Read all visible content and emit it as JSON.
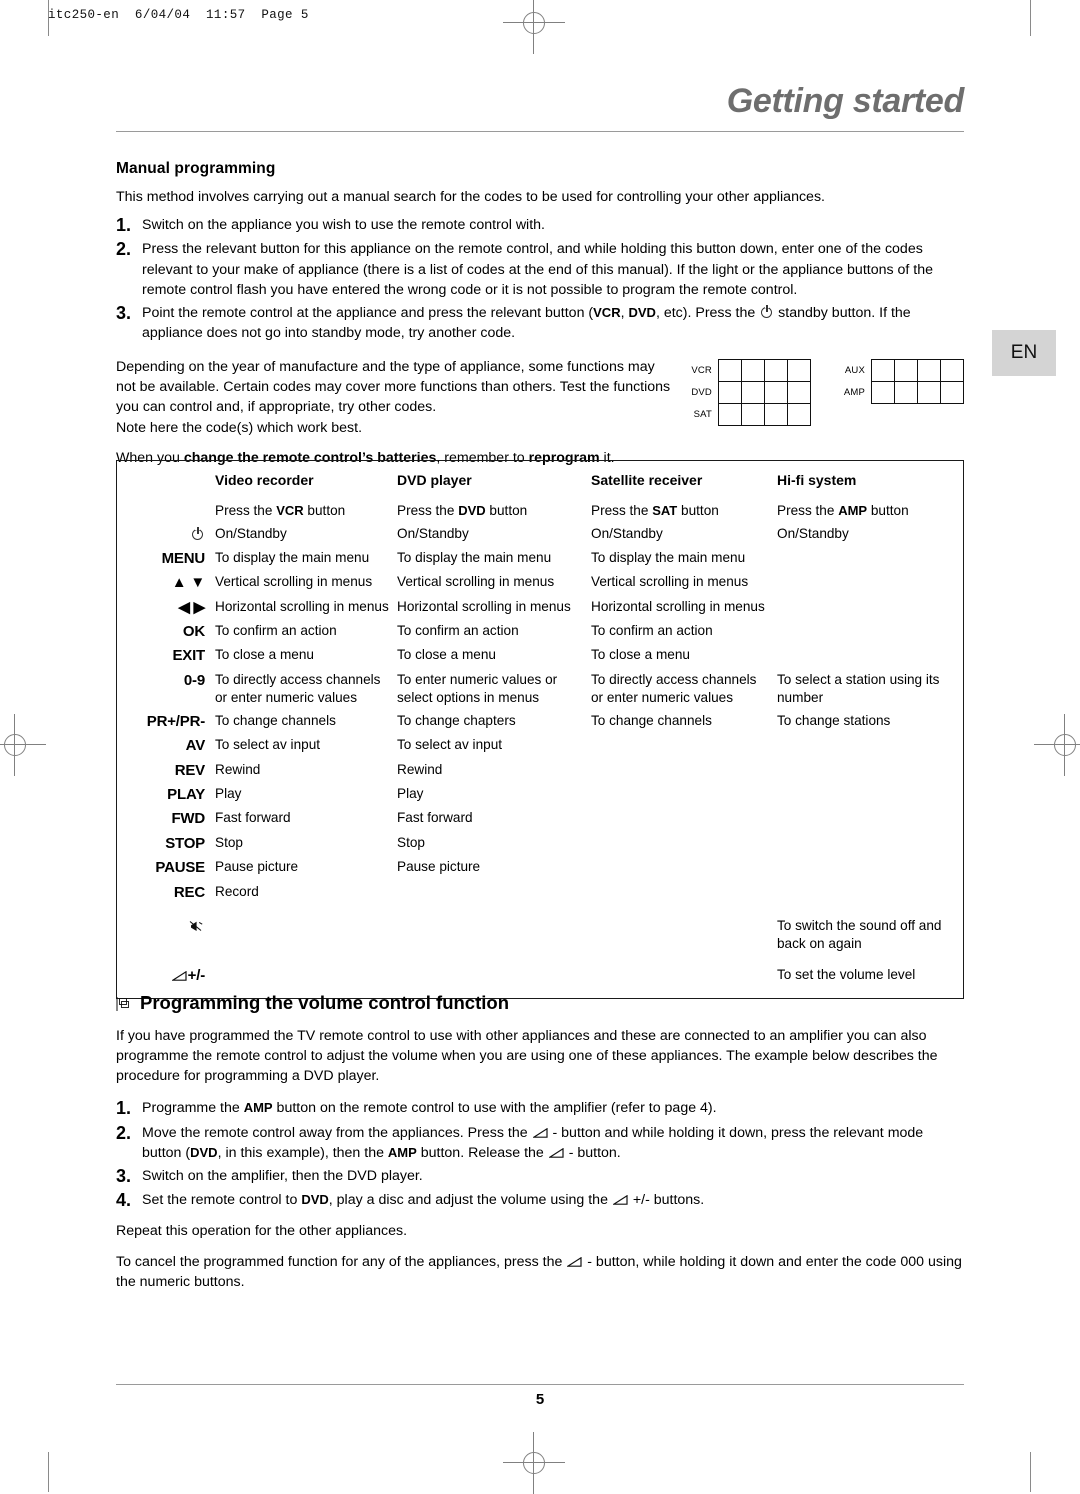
{
  "print_header": "itc250-en  6/04/04  11:57  Page 5",
  "chapter_title": "Getting started",
  "language_tab": "EN",
  "page_number": "5",
  "section1": {
    "subhead": "Manual programming",
    "intro": "This method involves carrying out a manual search for the codes to be used for controlling your other appliances.",
    "steps": [
      {
        "num": "1.",
        "text": "Switch on the appliance you wish to use the remote control with."
      },
      {
        "num": "2.",
        "text": "Press the relevant button for this appliance on the remote control, and while holding this button down, enter one of the codes relevant to your make of appliance (there is a list of codes at the end of this manual). If the light or the appliance buttons of the remote control flash you have entered the wrong code or it is not possible to program the remote control."
      },
      {
        "num": "3.",
        "text_a": "Point the remote control at the appliance and press the relevant button (",
        "bold_1": "VCR",
        "sep_1": ", ",
        "bold_2": "DVD",
        "text_b": ", etc). Press the ",
        "text_c": " standby button. If the appliance does not go into standby mode, try another code."
      }
    ],
    "note_paragraph": "Depending on the year of manufacture and the type of appliance, some functions may not be available. Certain codes may cover more functions than others. Test the functions you can control and, if appropriate, try other codes.",
    "note_line": "Note here the code(s) which work best.",
    "battery_note": {
      "lead": "When you ",
      "bold_1": "change the remote control’s batteries",
      "mid": ", remember to ",
      "bold_2": "reprogram",
      "tail": " it."
    },
    "code_grids": [
      {
        "labels": [
          "VCR",
          "DVD",
          "SAT"
        ],
        "rows": 3,
        "cols": 4
      },
      {
        "labels": [
          "AUX",
          "AMP"
        ],
        "rows": 2,
        "cols": 4
      }
    ]
  },
  "function_table": {
    "columns": [
      "",
      "Video recorder",
      "DVD player",
      "Satellite receiver",
      "Hi-fi system"
    ],
    "rows": [
      {
        "key": "",
        "key_icon": "",
        "cells": [
          "Press the VCR button",
          "Press the DVD button",
          "Press the SAT button",
          "Press the AMP button"
        ],
        "bold_tokens": [
          "VCR",
          "DVD",
          "SAT",
          "AMP"
        ]
      },
      {
        "key": "",
        "key_icon": "standby-icon",
        "cells": [
          "On/Standby",
          "On/Standby",
          "On/Standby",
          "On/Standby"
        ]
      },
      {
        "key": "MENU",
        "key_icon": "",
        "cells": [
          "To display the main menu",
          "To display the main menu",
          "To display the main menu",
          ""
        ]
      },
      {
        "key": "▲ ▼",
        "key_icon": "updown-arrows-icon",
        "cells": [
          "Vertical scrolling in menus",
          "Vertical scrolling in menus",
          "Vertical scrolling in menus",
          ""
        ]
      },
      {
        "key": "◀ ▶",
        "key_icon": "leftright-arrows-icon",
        "cells": [
          "Horizontal scrolling in menus",
          "Horizontal scrolling in menus",
          "Horizontal scrolling in menus",
          ""
        ]
      },
      {
        "key": "OK",
        "key_icon": "",
        "cells": [
          "To confirm an action",
          "To confirm an action",
          "To confirm an action",
          ""
        ]
      },
      {
        "key": "EXIT",
        "key_icon": "",
        "cells": [
          "To close a menu",
          "To close a menu",
          "To close a menu",
          ""
        ]
      },
      {
        "key": "0-9",
        "key_icon": "",
        "cells": [
          "To directly access channels or enter numeric values",
          "To enter numeric values or select options in menus",
          "To directly access channels or enter numeric values",
          "To select a station using its number"
        ]
      },
      {
        "key": "PR+/PR-",
        "key_icon": "",
        "cells": [
          "To change channels",
          "To change chapters",
          "To change channels",
          "To change stations"
        ]
      },
      {
        "key": "AV",
        "key_icon": "",
        "cells": [
          "To select av input",
          "To select av input",
          "",
          ""
        ]
      },
      {
        "key": "REV",
        "key_icon": "",
        "cells": [
          "Rewind",
          "Rewind",
          "",
          ""
        ]
      },
      {
        "key": "PLAY",
        "key_icon": "",
        "cells": [
          "Play",
          "Play",
          "",
          ""
        ]
      },
      {
        "key": "FWD",
        "key_icon": "",
        "cells": [
          "Fast forward",
          "Fast forward",
          "",
          ""
        ]
      },
      {
        "key": "STOP",
        "key_icon": "",
        "cells": [
          "Stop",
          "Stop",
          "",
          ""
        ]
      },
      {
        "key": "PAUSE",
        "key_icon": "",
        "cells": [
          "Pause picture",
          "Pause picture",
          "",
          ""
        ]
      },
      {
        "key": "REC",
        "key_icon": "",
        "cells": [
          "Record",
          "",
          "",
          ""
        ]
      },
      {
        "key": "",
        "key_icon": "mute-icon",
        "cells": [
          "",
          "",
          "",
          "To switch the sound off and back on again"
        ]
      },
      {
        "key": "+/-",
        "key_icon": "volume-icon",
        "cells": [
          "",
          "",
          "",
          "To set the volume level"
        ]
      }
    ]
  },
  "section2": {
    "heading": "Programming the volume control function",
    "intro": "If you have programmed the TV remote control to use with other appliances and these are connected to an amplifier you can also programme the remote control to adjust the volume when you are using one of these appliances. The example below describes the procedure for programming a DVD player.",
    "steps": [
      {
        "num": "1.",
        "a": "Programme the ",
        "bold_1": "AMP",
        "b": " button on the remote control to use with the amplifier (refer to page 4)."
      },
      {
        "num": "2.",
        "a": "Move the remote control away from the appliances. Press the ",
        "b": " - button and while holding it down, press the relevant mode button (",
        "bold_1": "DVD",
        "c": ", in this example), then the ",
        "bold_2": "AMP",
        "d": " button. Release the ",
        "e": " - button."
      },
      {
        "num": "3.",
        "a": "Switch on the amplifier, then the DVD player.",
        "b": "",
        "c": "",
        "d": "",
        "e": ""
      },
      {
        "num": "4.",
        "a": "Set the remote control to ",
        "bold_1": "DVD",
        "b": ", play a disc and adjust the volume using the ",
        "c": " +/- buttons.",
        "d": "",
        "e": ""
      }
    ],
    "repeat_note": "Repeat this operation for the other appliances.",
    "cancel_note": {
      "a": "To cancel the programmed function for any of the appliances, press the ",
      "b": " - button, while holding it down and enter the code 000 using the numeric buttons."
    }
  },
  "colors": {
    "title_gray": "#6e6e6e",
    "tab_gray": "#d4d4d4",
    "rule_gray": "#9a9a9a",
    "table_border": "#1a1a1a"
  }
}
